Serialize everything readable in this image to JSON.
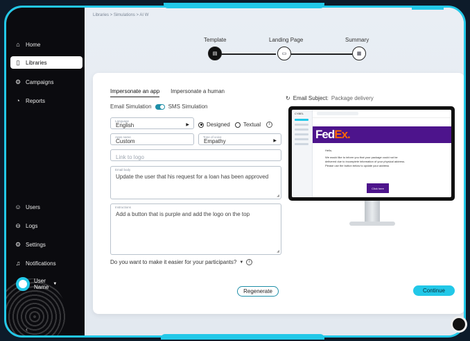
{
  "breadcrumb": "Libraries > Simulations > AI W",
  "sidebar": {
    "items": [
      {
        "label": "Home",
        "icon": "home-icon",
        "glyph": "⌂"
      },
      {
        "label": "Libraries",
        "icon": "libraries-icon",
        "glyph": "▯"
      },
      {
        "label": "Campaigns",
        "icon": "campaigns-icon",
        "glyph": "⚙"
      },
      {
        "label": "Reports",
        "icon": "reports-icon",
        "glyph": "◔"
      }
    ],
    "bottom_items": [
      {
        "label": "Users",
        "icon": "users-icon",
        "glyph": "☺"
      },
      {
        "label": "Logs",
        "icon": "logs-icon",
        "glyph": "⊖"
      },
      {
        "label": "Settings",
        "icon": "settings-icon",
        "glyph": "⚙"
      },
      {
        "label": "Notifications",
        "icon": "bell-icon",
        "glyph": "♫"
      }
    ],
    "user": {
      "line1": "User",
      "line2": "Name"
    }
  },
  "stepper": {
    "steps": [
      {
        "label": "Template",
        "active": true
      },
      {
        "label": "Landing Page",
        "active": false
      },
      {
        "label": "Summary",
        "active": false
      }
    ]
  },
  "form": {
    "tabs": [
      "Impersonate an app",
      "Impersonate a human"
    ],
    "email_sim": "Email Simulation",
    "sms_sim": "SMS Simulation",
    "language": {
      "label": "Language",
      "value": "English"
    },
    "designed": "Designed",
    "textual": "Textual",
    "apps_name": {
      "label": "Apps name",
      "value": "Custom"
    },
    "tone": {
      "label": "Tone of voice",
      "value": "Empathy"
    },
    "logo": {
      "placeholder": "Link to logo"
    },
    "email_body": {
      "label": "Email body",
      "value": "Update the user that his request for a loan has been approved"
    },
    "instructions": {
      "label": "Instructions",
      "value": "Add a button that is purple and add the logo on the top"
    },
    "easier": "Do you want to make it easier for your participants?",
    "regenerate": "Regenerate",
    "continue": "Continue"
  },
  "preview": {
    "subject_label": "Email Subject:",
    "subject_value": "Package delivery",
    "app_name": "CYBEL",
    "brand_fed": "Fed",
    "brand_ex": "Ex",
    "brand_dot": ".",
    "hello": "Hello,",
    "body1": "We would like to inform you that your package could not be delivered due to incomplete information of your physical address.",
    "body2": "Please use the button below to update your address",
    "cta": "Click here"
  },
  "colors": {
    "accent": "#22c8e8",
    "fedex_purple": "#4d148c",
    "fedex_orange": "#ff6600"
  }
}
